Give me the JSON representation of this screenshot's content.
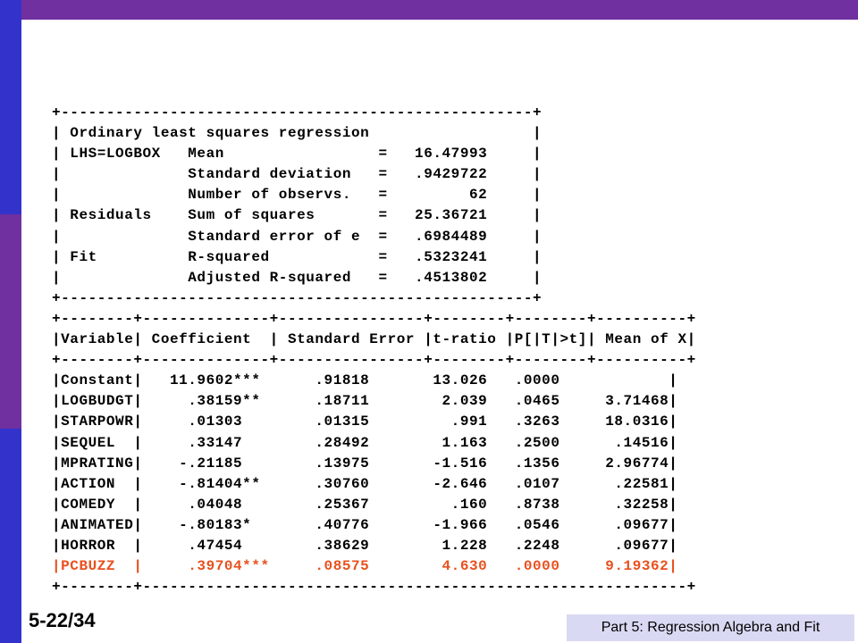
{
  "colors": {
    "top_bar": "#7030a0",
    "left_bar_blue": "#3333cc",
    "left_bar_purple": "#7030a0",
    "highlight_row": "#e8501e",
    "footer_bg": "#d9d9f3"
  },
  "output_lines": [
    {
      "text": "+----------------------------------------------------+",
      "highlight": false
    },
    {
      "text": "| Ordinary least squares regression                  |",
      "highlight": false
    },
    {
      "text": "| LHS=LOGBOX   Mean                 =   16.47993     |",
      "highlight": false
    },
    {
      "text": "|              Standard deviation   =   .9429722     |",
      "highlight": false
    },
    {
      "text": "|              Number of observs.   =         62     |",
      "highlight": false
    },
    {
      "text": "| Residuals    Sum of squares       =   25.36721     |",
      "highlight": false
    },
    {
      "text": "|              Standard error of e  =   .6984489     |",
      "highlight": false
    },
    {
      "text": "| Fit          R-squared            =   .5323241     |",
      "highlight": false
    },
    {
      "text": "|              Adjusted R-squared   =   .4513802     |",
      "highlight": false
    },
    {
      "text": "+----------------------------------------------------+",
      "highlight": false
    },
    {
      "text": "+--------+--------------+----------------+--------+--------+----------+",
      "highlight": false
    },
    {
      "text": "|Variable| Coefficient  | Standard Error |t-ratio |P[|T|>t]| Mean of X|",
      "highlight": false
    },
    {
      "text": "+--------+--------------+----------------+--------+--------+----------+",
      "highlight": false
    },
    {
      "text": "|Constant|   11.9602***      .91818       13.026   .0000            |",
      "highlight": false
    },
    {
      "text": "|LOGBUDGT|     .38159**      .18711        2.039   .0465     3.71468|",
      "highlight": false
    },
    {
      "text": "|STARPOWR|     .01303        .01315         .991   .3263     18.0316|",
      "highlight": false
    },
    {
      "text": "|SEQUEL  |     .33147        .28492        1.163   .2500      .14516|",
      "highlight": false
    },
    {
      "text": "|MPRATING|    -.21185        .13975       -1.516   .1356     2.96774|",
      "highlight": false
    },
    {
      "text": "|ACTION  |    -.81404**      .30760       -2.646   .0107      .22581|",
      "highlight": false
    },
    {
      "text": "|COMEDY  |     .04048        .25367         .160   .8738      .32258|",
      "highlight": false
    },
    {
      "text": "|ANIMATED|    -.80183*       .40776       -1.966   .0546      .09677|",
      "highlight": false
    },
    {
      "text": "|HORROR  |     .47454        .38629        1.228   .2248      .09677|",
      "highlight": false
    },
    {
      "text": "|PCBUZZ  |     .39704***     .08575        4.630   .0000     9.19362|",
      "highlight": true
    },
    {
      "text": "+--------+------------------------------------------------------------+",
      "highlight": false
    }
  ],
  "footer": {
    "slide_number": "5-22/34",
    "section_label": "Part 5: Regression Algebra and Fit"
  }
}
